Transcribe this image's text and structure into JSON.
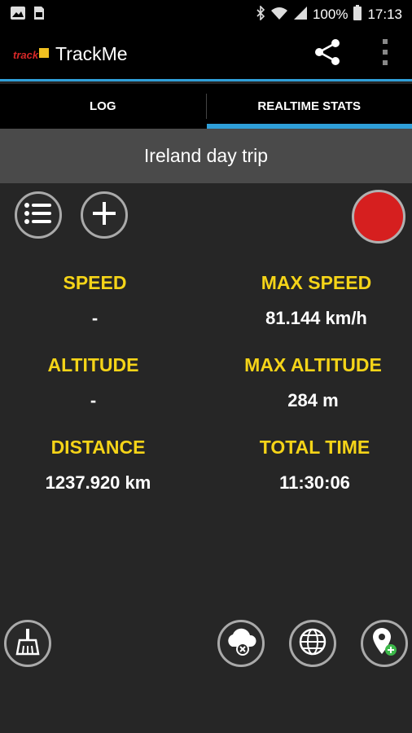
{
  "status_bar": {
    "battery_text": "100%",
    "time": "17:13",
    "icons": [
      "gallery-icon",
      "sim-icon",
      "bluetooth-icon",
      "wifi-icon",
      "signal-icon",
      "battery-icon"
    ]
  },
  "app_bar": {
    "title": "TrackMe",
    "logo_text": "track",
    "actions": [
      "share-icon",
      "overflow-menu-icon"
    ]
  },
  "tabs": [
    {
      "label": "LOG",
      "active": false
    },
    {
      "label": "REALTIME STATS",
      "active": true
    }
  ],
  "trip": {
    "title": "Ireland day trip"
  },
  "stats": {
    "speed": {
      "label": "SPEED",
      "value": "-"
    },
    "max_speed": {
      "label": "MAX SPEED",
      "value": "81.144 km/h"
    },
    "altitude": {
      "label": "ALTITUDE",
      "value": "-"
    },
    "max_altitude": {
      "label": "MAX ALTITUDE",
      "value": "284 m"
    },
    "distance": {
      "label": "DISTANCE",
      "value": "1237.920 km"
    },
    "total_time": {
      "label": "TOTAL TIME",
      "value": "11:30:06"
    }
  },
  "colors": {
    "accent": "#2f9fd8",
    "label_yellow": "#f5d418",
    "record_red": "#d61f1f",
    "background": "#262626",
    "trip_bar": "#4a4a4a"
  },
  "controls": {
    "top": [
      "list-icon",
      "add-icon",
      "record-icon"
    ],
    "bottom": [
      "broom-icon",
      "cloud-remove-icon",
      "globe-icon",
      "add-location-icon"
    ]
  }
}
